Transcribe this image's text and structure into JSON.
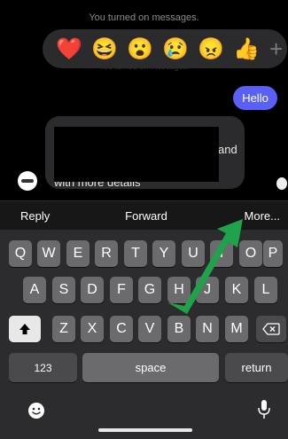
{
  "chat": {
    "system_message": "You turned on messages.",
    "system_message_faded": "You turned on messages.",
    "sent_message": "Hello",
    "received_message_visible_fragment": "and"
  },
  "reactions": [
    {
      "icon": "heart-emoji",
      "glyph": "❤️"
    },
    {
      "icon": "laughing-emoji",
      "glyph": "😆"
    },
    {
      "icon": "surprised-emoji",
      "glyph": "😮"
    },
    {
      "icon": "crying-emoji",
      "glyph": "😢"
    },
    {
      "icon": "angry-emoji",
      "glyph": "😠"
    },
    {
      "icon": "thumbs-up-emoji",
      "glyph": "👍"
    }
  ],
  "reaction_add": "+",
  "actions": {
    "reply": "Reply",
    "forward": "Forward",
    "more": "More..."
  },
  "keyboard": {
    "row1": [
      "Q",
      "W",
      "E",
      "R",
      "T",
      "Y",
      "U",
      "I",
      "O",
      "P"
    ],
    "row2": [
      "A",
      "S",
      "D",
      "F",
      "G",
      "H",
      "J",
      "K",
      "L"
    ],
    "row3": [
      "Z",
      "X",
      "C",
      "V",
      "B",
      "N",
      "M"
    ],
    "numbers_key": "123",
    "space_key": "space",
    "return_key": "return",
    "shift_icon": "shift-arrow-icon",
    "backspace_icon": "backspace-icon",
    "emoji_icon": "emoji-icon",
    "mic_icon": "microphone-icon"
  },
  "colors": {
    "sent_bubble": "#5a5ff5",
    "annotation_arrow": "#1fa24a"
  }
}
